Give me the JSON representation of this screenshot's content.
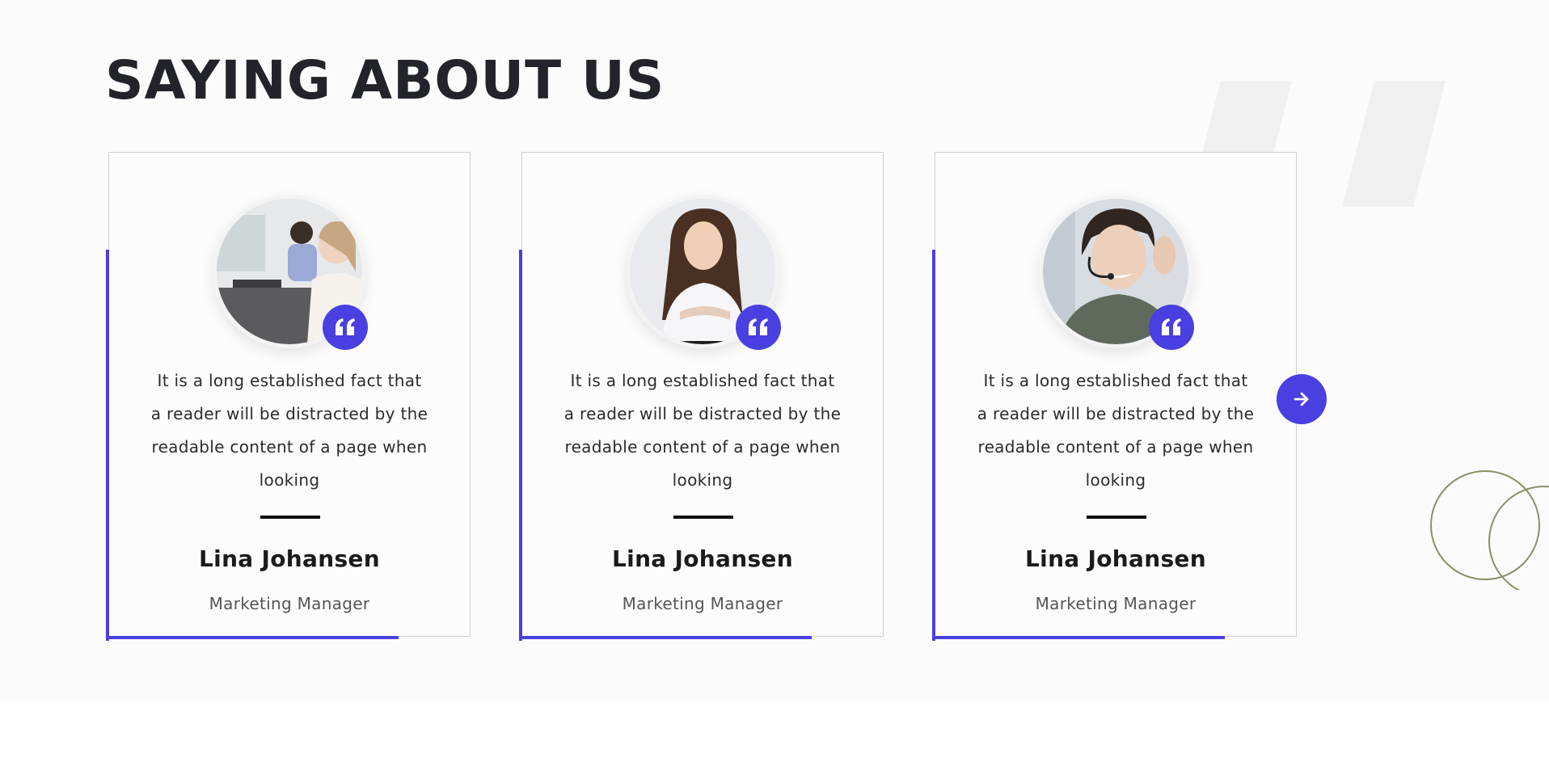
{
  "section": {
    "title": "SAYING ABOUT US"
  },
  "testimonials": [
    {
      "quote": "It is a long established fact that a reader will be distracted by the readable content of a page when looking",
      "name": "Lina Johansen",
      "role": "Marketing Manager",
      "avatar": "woman-at-office-desk-photo"
    },
    {
      "quote": "It is a long established fact that a reader will be distracted by the readable content of a page when looking",
      "name": "Lina Johansen",
      "role": "Marketing Manager",
      "avatar": "woman-with-headset-arms-crossed-photo"
    },
    {
      "quote": "It is a long established fact that a reader will be distracted by the readable content of a page when looking",
      "name": "Lina Johansen",
      "role": "Marketing Manager",
      "avatar": "woman-with-headset-ok-gesture-photo"
    }
  ],
  "icons": {
    "quote": "quote-icon",
    "next": "arrow-right-icon"
  },
  "colors": {
    "accent": "#4a3fe0",
    "heading": "#23242a",
    "section_bg": "#fbfbfb",
    "decor_circle": "#8a8f68",
    "decor_quote": "#f0f0f0"
  }
}
